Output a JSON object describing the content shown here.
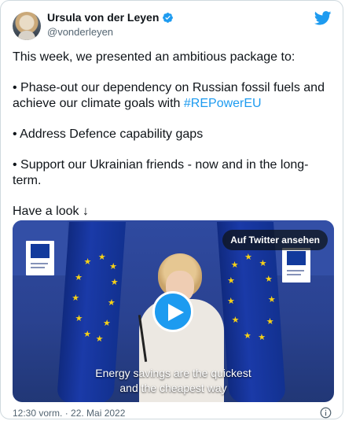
{
  "author": {
    "display_name": "Ursula von der Leyen",
    "handle": "@vonderleyen",
    "verified": true
  },
  "tweet": {
    "intro": "This week, we presented an ambitious package to:",
    "bullet1_text": "• Phase-out our dependency on Russian fossil fuels and achieve our climate goals with ",
    "bullet1_hashtag": "#REPowerEU",
    "bullet2": "• Address Defence capability gaps",
    "bullet3": "• Support our Ukrainian friends - now and in the long-term.",
    "outro": "Have a look ↓"
  },
  "media": {
    "view_button": "Auf Twitter ansehen",
    "caption_line1": "Energy savings are the quickest",
    "caption_line2": "and the cheapest way",
    "logo_left_text": "European Commission",
    "logo_right_text": "Commission européenne"
  },
  "footer": {
    "timestamp": "12:30 vorm. · 22. Mai 2022"
  },
  "icons": {
    "verified": "verified-badge-icon",
    "brand": "twitter-bird-icon",
    "play": "play-icon",
    "info": "info-icon"
  },
  "colors": {
    "accent": "#1d9bf0",
    "text": "#0f1419",
    "muted": "#536471",
    "border": "#cfd9de"
  }
}
